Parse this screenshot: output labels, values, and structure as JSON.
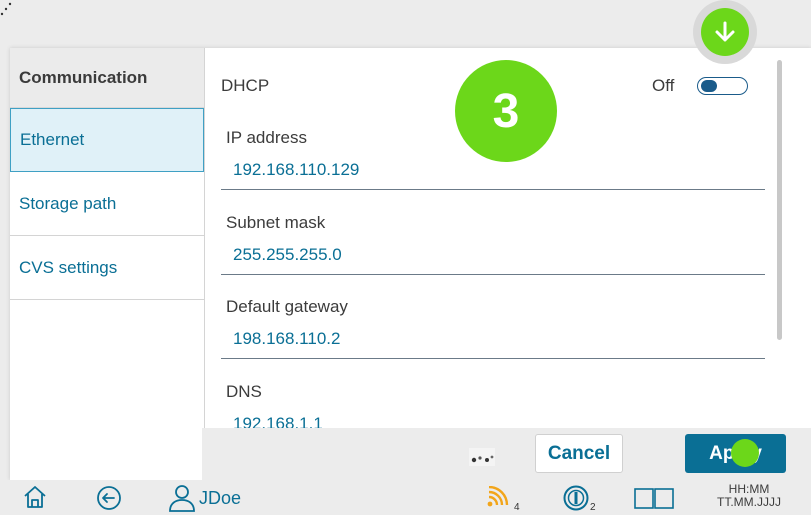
{
  "sidebar": {
    "header": "Communication",
    "items": [
      {
        "label": "Ethernet"
      },
      {
        "label": "Storage path"
      },
      {
        "label": "CVS settings"
      }
    ]
  },
  "dhcp": {
    "label": "DHCP",
    "state": "Off"
  },
  "fields": [
    {
      "label": "IP address",
      "value": "192.168.110.129"
    },
    {
      "label": "Subnet mask",
      "value": "255.255.255.0"
    },
    {
      "label": "Default gateway",
      "value": "198.168.110.2"
    },
    {
      "label": "DNS",
      "value": "192.168.1.1"
    }
  ],
  "actions": {
    "cancel": "Cancel",
    "apply": "Apply"
  },
  "step_badge": "3",
  "statusbar": {
    "user": "JDoe",
    "wifi_count": "4",
    "info_count": "2",
    "time": "HH:MM",
    "date": "TT.MM.JJJJ"
  },
  "colors": {
    "accent": "#0a6f95",
    "highlight": "#6cd71a"
  },
  "icons": [
    "home-icon",
    "logout-icon",
    "user-icon",
    "wifi-icon",
    "info-icon",
    "book-icon",
    "download-icon"
  ]
}
